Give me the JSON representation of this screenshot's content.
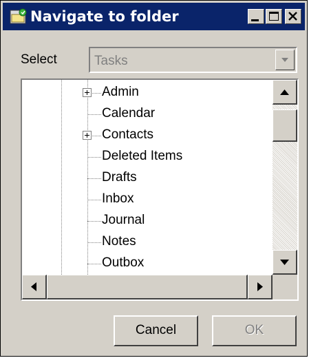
{
  "window": {
    "title": "Navigate to folder"
  },
  "select": {
    "label": "Select",
    "value": "Tasks"
  },
  "tree": {
    "items": [
      {
        "label": "Admin",
        "expandable": true
      },
      {
        "label": "Calendar",
        "expandable": false
      },
      {
        "label": "Contacts",
        "expandable": true
      },
      {
        "label": "Deleted Items",
        "expandable": false
      },
      {
        "label": "Drafts",
        "expandable": false
      },
      {
        "label": "Inbox",
        "expandable": false
      },
      {
        "label": "Journal",
        "expandable": false
      },
      {
        "label": "Notes",
        "expandable": false
      },
      {
        "label": "Outbox",
        "expandable": false
      }
    ]
  },
  "buttons": {
    "cancel": "Cancel",
    "ok": "OK"
  },
  "colors": {
    "title_bar": "#0a246a",
    "face": "#d4d0c8",
    "disabled_text": "#808080"
  }
}
